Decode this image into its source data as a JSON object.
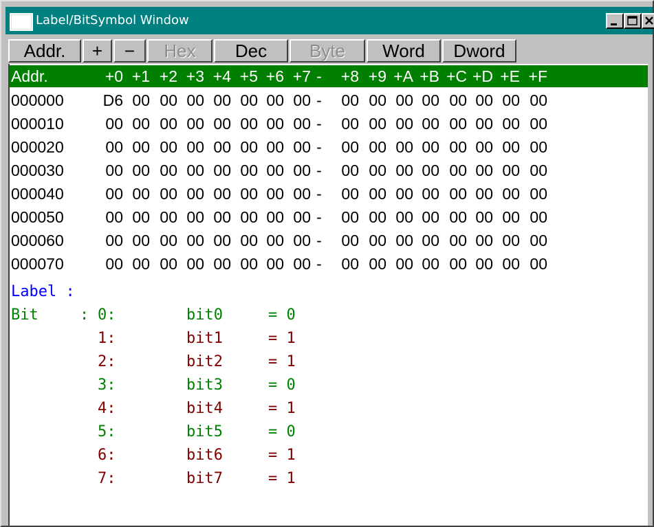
{
  "window": {
    "title": "Label/BitSymbol Window",
    "controls": [
      "minimize-icon",
      "maximize-icon",
      "close-icon"
    ],
    "titlebar_color": "#008080"
  },
  "toolbar": {
    "buttons": [
      {
        "label": "Addr.",
        "enabled": true
      },
      {
        "label": "+",
        "enabled": true
      },
      {
        "label": "−",
        "enabled": true
      },
      {
        "label": "Hex",
        "enabled": false
      },
      {
        "label": "Dec",
        "enabled": true
      },
      {
        "label": "Byte",
        "enabled": false
      },
      {
        "label": "Word",
        "enabled": true
      },
      {
        "label": "Dword",
        "enabled": true
      }
    ]
  },
  "memory": {
    "header_label": "Addr.",
    "columns": [
      "+0",
      "+1",
      "+2",
      "+3",
      "+4",
      "+5",
      "+6",
      "+7",
      "-",
      "+8",
      "+9",
      "+A",
      "+B",
      "+C",
      "+D",
      "+E",
      "+F"
    ],
    "rows": [
      {
        "addr": "000000",
        "bytes": [
          "D6",
          "00",
          "00",
          "00",
          "00",
          "00",
          "00",
          "00",
          "-",
          "00",
          "00",
          "00",
          "00",
          "00",
          "00",
          "00",
          "00"
        ]
      },
      {
        "addr": "000010",
        "bytes": [
          "00",
          "00",
          "00",
          "00",
          "00",
          "00",
          "00",
          "00",
          "-",
          "00",
          "00",
          "00",
          "00",
          "00",
          "00",
          "00",
          "00"
        ]
      },
      {
        "addr": "000020",
        "bytes": [
          "00",
          "00",
          "00",
          "00",
          "00",
          "00",
          "00",
          "00",
          "-",
          "00",
          "00",
          "00",
          "00",
          "00",
          "00",
          "00",
          "00"
        ]
      },
      {
        "addr": "000030",
        "bytes": [
          "00",
          "00",
          "00",
          "00",
          "00",
          "00",
          "00",
          "00",
          "-",
          "00",
          "00",
          "00",
          "00",
          "00",
          "00",
          "00",
          "00"
        ]
      },
      {
        "addr": "000040",
        "bytes": [
          "00",
          "00",
          "00",
          "00",
          "00",
          "00",
          "00",
          "00",
          "-",
          "00",
          "00",
          "00",
          "00",
          "00",
          "00",
          "00",
          "00"
        ]
      },
      {
        "addr": "000050",
        "bytes": [
          "00",
          "00",
          "00",
          "00",
          "00",
          "00",
          "00",
          "00",
          "-",
          "00",
          "00",
          "00",
          "00",
          "00",
          "00",
          "00",
          "00"
        ]
      },
      {
        "addr": "000060",
        "bytes": [
          "00",
          "00",
          "00",
          "00",
          "00",
          "00",
          "00",
          "00",
          "-",
          "00",
          "00",
          "00",
          "00",
          "00",
          "00",
          "00",
          "00"
        ]
      },
      {
        "addr": "000070",
        "bytes": [
          "00",
          "00",
          "00",
          "00",
          "00",
          "00",
          "00",
          "00",
          "-",
          "00",
          "00",
          "00",
          "00",
          "00",
          "00",
          "00",
          "00"
        ]
      }
    ],
    "header_color": "#007f00"
  },
  "symbols": {
    "label_line": "Label :",
    "bit_label": "Bit",
    "bit_colon": ":",
    "bits": [
      {
        "index": "0:",
        "name": "bit0",
        "value": "= 0",
        "color": "#008000"
      },
      {
        "index": "1:",
        "name": "bit1",
        "value": "= 1",
        "color": "#800000"
      },
      {
        "index": "2:",
        "name": "bit2",
        "value": "= 1",
        "color": "#800000"
      },
      {
        "index": "3:",
        "name": "bit3",
        "value": "= 0",
        "color": "#008000"
      },
      {
        "index": "4:",
        "name": "bit4",
        "value": "= 1",
        "color": "#800000"
      },
      {
        "index": "5:",
        "name": "bit5",
        "value": "= 0",
        "color": "#008000"
      },
      {
        "index": "6:",
        "name": "bit6",
        "value": "= 1",
        "color": "#800000"
      },
      {
        "index": "7:",
        "name": "bit7",
        "value": "= 1",
        "color": "#800000"
      }
    ],
    "label_color": "#0000ff"
  }
}
